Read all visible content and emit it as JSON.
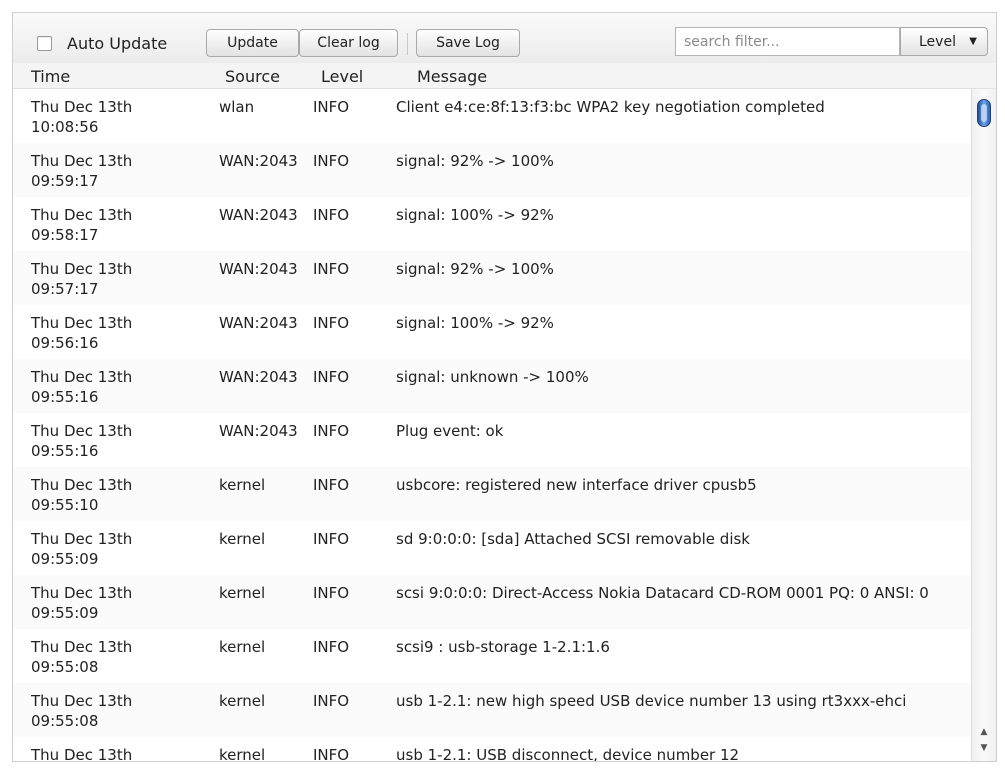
{
  "toolbar": {
    "auto_update_label": "Auto Update",
    "auto_update_checked": false,
    "update_label": "Update",
    "clear_log_label": "Clear log",
    "save_log_label": "Save Log",
    "search_placeholder": "search filter...",
    "search_value": "",
    "level_label": "Level",
    "level_icon": "chevron-down-icon"
  },
  "table": {
    "columns": [
      "Time",
      "Source",
      "Level",
      "Message"
    ],
    "rows": [
      {
        "date": "Thu Dec 13th",
        "time": "10:08:56",
        "source": "wlan",
        "level": "INFO",
        "message": "Client e4:ce:8f:13:f3:bc WPA2 key negotiation completed"
      },
      {
        "date": "Thu Dec 13th",
        "time": "09:59:17",
        "source": "WAN:2043",
        "level": "INFO",
        "message": "signal: 92% -> 100%"
      },
      {
        "date": "Thu Dec 13th",
        "time": "09:58:17",
        "source": "WAN:2043",
        "level": "INFO",
        "message": "signal: 100% -> 92%"
      },
      {
        "date": "Thu Dec 13th",
        "time": "09:57:17",
        "source": "WAN:2043",
        "level": "INFO",
        "message": "signal: 92% -> 100%"
      },
      {
        "date": "Thu Dec 13th",
        "time": "09:56:16",
        "source": "WAN:2043",
        "level": "INFO",
        "message": "signal: 100% -> 92%"
      },
      {
        "date": "Thu Dec 13th",
        "time": "09:55:16",
        "source": "WAN:2043",
        "level": "INFO",
        "message": "signal: unknown -> 100%"
      },
      {
        "date": "Thu Dec 13th",
        "time": "09:55:16",
        "source": "WAN:2043",
        "level": "INFO",
        "message": "Plug event: ok"
      },
      {
        "date": "Thu Dec 13th",
        "time": "09:55:10",
        "source": "kernel",
        "level": "INFO",
        "message": "usbcore: registered new interface driver cpusb5"
      },
      {
        "date": "Thu Dec 13th",
        "time": "09:55:09",
        "source": "kernel",
        "level": "INFO",
        "message": "sd 9:0:0:0: [sda] Attached SCSI removable disk"
      },
      {
        "date": "Thu Dec 13th",
        "time": "09:55:09",
        "source": "kernel",
        "level": "INFO",
        "message": "scsi 9:0:0:0: Direct-Access Nokia Datacard CD-ROM 0001 PQ: 0 ANSI: 0"
      },
      {
        "date": "Thu Dec 13th",
        "time": "09:55:08",
        "source": "kernel",
        "level": "INFO",
        "message": "scsi9 : usb-storage 1-2.1:1.6"
      },
      {
        "date": "Thu Dec 13th",
        "time": "09:55:08",
        "source": "kernel",
        "level": "INFO",
        "message": "usb 1-2.1: new high speed USB device number 13 using rt3xxx-ehci"
      },
      {
        "date": "Thu Dec 13th",
        "time": "",
        "source": "kernel",
        "level": "INFO",
        "message": "usb 1-2.1: USB disconnect, device number 12"
      }
    ]
  },
  "scrollbar": {
    "thumb_icon": "scroll-thumb",
    "up_icon": "arrow-up-icon",
    "down_icon": "arrow-down-icon",
    "thumb_color": "#3b7bd6"
  }
}
